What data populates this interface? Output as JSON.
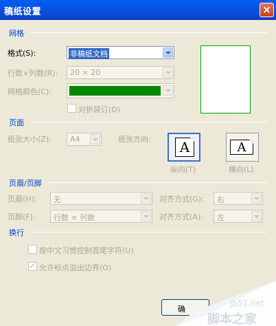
{
  "title": "稿纸设置",
  "close_label": "×",
  "grid": {
    "section": "网格",
    "style_label": "格式(S):",
    "style_value": "非稿纸文档",
    "rowcol_label": "行数×列数(R):",
    "rowcol_value": "20 × 20",
    "color_label": "网格颜色(C):",
    "color_value": "#008800",
    "fold_label": "对折装订(D)",
    "preview_border": "#00a000"
  },
  "page": {
    "section": "页面",
    "size_label": "纸张大小(Z):",
    "size_value": "A4",
    "orient_label": "纸张方向:",
    "portrait_label": "纵向(T)",
    "landscape_label": "横向(L)",
    "glyph": "A"
  },
  "headerfooter": {
    "section": "页眉/页脚",
    "header_label": "页眉(H):",
    "header_value": "无",
    "header_align_label": "对齐方式(G):",
    "header_align_value": "右",
    "footer_label": "页脚(F):",
    "footer_value": "行数 × 列数",
    "footer_align_label": "对齐方式(A):",
    "footer_align_value": "左"
  },
  "wrap": {
    "section": "换行",
    "opt1": "按中文习惯控制首尾字符(U)",
    "opt2": "允许标点溢出边界(O)"
  },
  "buttons": {
    "ok": "确"
  },
  "watermark": {
    "site": "jb51.net",
    "name": "脚本之家"
  }
}
